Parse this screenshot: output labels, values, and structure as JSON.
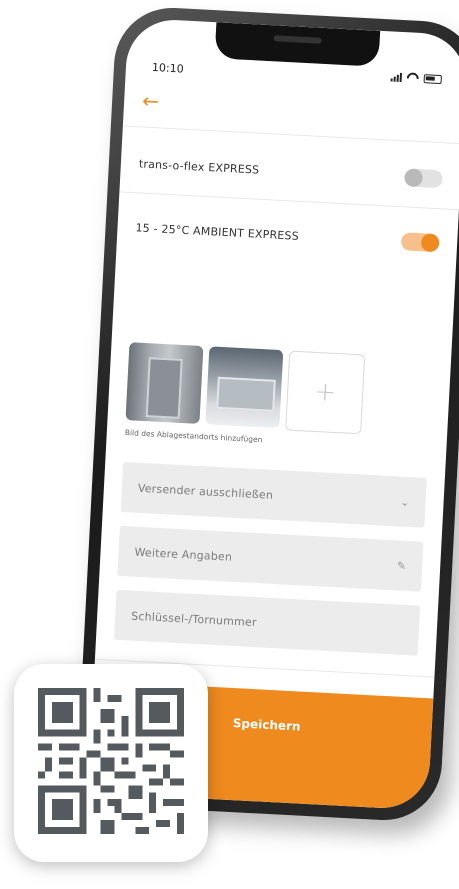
{
  "status_bar": {
    "time": "10:10"
  },
  "header": {
    "back_icon": "arrow-left-icon"
  },
  "services": [
    {
      "label": "trans-o-flex EXPRESS",
      "enabled": false
    },
    {
      "label": "15 - 25°C AMBIENT EXPRESS",
      "enabled": true
    }
  ],
  "photos": {
    "count": 2,
    "add_symbol": "+",
    "caption": "Bild des Ablagestandorts hinzufügen"
  },
  "form": {
    "sender_exclude": {
      "label": "Versender ausschließen",
      "icon": "chevron-down-icon"
    },
    "more_info": {
      "label": "Weitere Angaben",
      "icon": "pencil-icon"
    },
    "key_number": {
      "label": "Schlüssel-/Tornummer"
    }
  },
  "footer": {
    "save_label": "Speichern"
  },
  "colors": {
    "accent": "#ee8a1e",
    "toggle_on_track": "#f6c08c",
    "field_bg": "#ececec"
  }
}
